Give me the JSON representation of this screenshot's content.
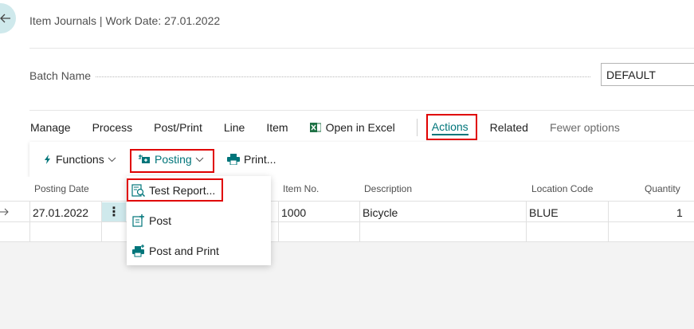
{
  "header": {
    "title": "Item Journals | Work Date: 27.01.2022"
  },
  "batch": {
    "label": "Batch Name",
    "value": "DEFAULT"
  },
  "menu": {
    "items": [
      "Manage",
      "Process",
      "Post/Print",
      "Line",
      "Item"
    ],
    "open_in_excel": "Open in Excel",
    "actions": "Actions",
    "related": "Related",
    "fewer_options": "Fewer options"
  },
  "toolbar": {
    "functions": "Functions",
    "posting": "Posting",
    "print": "Print..."
  },
  "dropdown": {
    "test_report": "Test Report...",
    "post": "Post",
    "post_and_print": "Post and Print"
  },
  "table": {
    "columns": {
      "posting_date": "Posting Date",
      "item_no": "Item No.",
      "description": "Description",
      "location_code": "Location Code",
      "quantity": "Quantity"
    },
    "rows": [
      {
        "posting_date": "27.01.2022",
        "item_no": "1000",
        "description": "Bicycle",
        "location_code": "BLUE",
        "quantity": "1"
      }
    ]
  },
  "colors": {
    "accent": "#00757a",
    "highlight": "#e00000"
  }
}
